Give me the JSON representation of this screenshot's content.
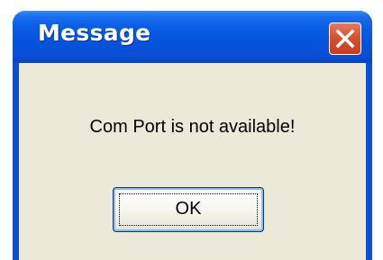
{
  "window": {
    "title": "Message",
    "close_icon": "close-x-icon"
  },
  "dialog": {
    "message": "Com Port is not available!",
    "ok_label": "OK"
  },
  "colors": {
    "titlebar": "#0553dd",
    "close_button": "#d8512f",
    "body_background": "#ece9d8",
    "button_border": "#003c74"
  }
}
